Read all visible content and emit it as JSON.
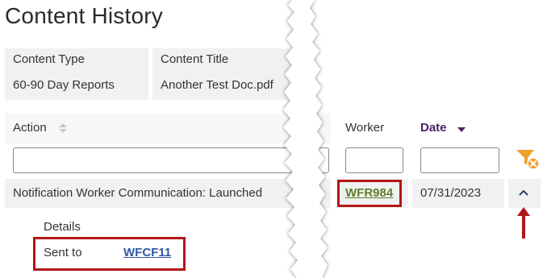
{
  "page": {
    "title": "Content History"
  },
  "content_table": {
    "headers": [
      "Content Type",
      "Content Title"
    ],
    "row": [
      "60-90 Day Reports",
      "Another Test Doc.pdf"
    ]
  },
  "history_table": {
    "columns": {
      "action": "Action",
      "worker": "Worker",
      "date": "Date"
    },
    "filters": {
      "action": "",
      "worker": "",
      "date": ""
    },
    "rows": [
      {
        "action": "Notification Worker Communication: Launched",
        "worker": "WFR984",
        "date": "07/31/2023"
      }
    ],
    "details": {
      "label": "Details",
      "sent_to_label": "Sent to",
      "sent_to_value": "WFCF11"
    }
  },
  "colors": {
    "highlight": "#b01818",
    "accent": "#4b1f6b",
    "filter_icon": "#f0a030"
  },
  "icons": [
    "sort-icon",
    "sort-desc-icon",
    "clear-filter-icon",
    "collapse-chevron-icon",
    "arrow-up-icon"
  ]
}
